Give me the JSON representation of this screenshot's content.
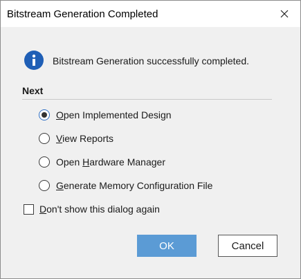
{
  "dialog": {
    "title": "Bitstream Generation Completed",
    "close_icon": "close-icon",
    "message_icon": "info-icon",
    "message": "Bitstream Generation successfully completed."
  },
  "next": {
    "heading": "Next",
    "options": [
      {
        "pre": "",
        "key": "O",
        "rest": "pen Implemented Design",
        "selected": true
      },
      {
        "pre": "",
        "key": "V",
        "rest": "iew Reports",
        "selected": false
      },
      {
        "pre": "Open ",
        "key": "H",
        "rest": "ardware Manager",
        "selected": false
      },
      {
        "pre": "",
        "key": "G",
        "rest": "enerate Memory Configuration File",
        "selected": false
      }
    ]
  },
  "dont_show": {
    "key": "D",
    "rest": "on't show this dialog again",
    "checked": false
  },
  "buttons": {
    "ok": "OK",
    "cancel": "Cancel"
  },
  "colors": {
    "accent": "#5b9bd5",
    "info_icon": "#1f5fb6"
  }
}
